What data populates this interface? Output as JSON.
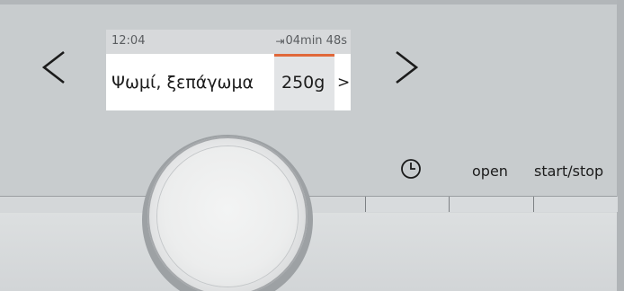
{
  "display": {
    "clock": "12:04",
    "remaining_icon": "⇥",
    "remaining_time": "04min 48s",
    "program_name": "Ψωμί, ξεπάγωμα",
    "weight": "250g",
    "weight_arrow": ">"
  },
  "controls": {
    "open_label": "open",
    "start_stop_label": "start/stop"
  },
  "icons": {
    "prev": "chevron-left-icon",
    "next": "chevron-right-icon",
    "timer": "clock-icon",
    "remaining": "remaining-time-icon"
  },
  "colors": {
    "panel": "#c8ccce",
    "display_bg": "#ffffff",
    "status_bar": "#d7d9db",
    "highlight_field": "#e2e4e6",
    "accent": "#e0683a",
    "text": "#1b1b1b"
  }
}
